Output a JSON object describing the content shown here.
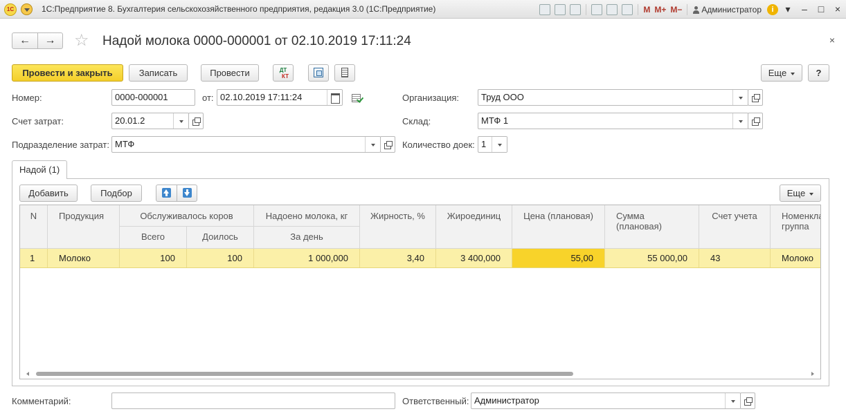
{
  "app": {
    "title": "1С:Предприятие 8. Бухгалтерия сельскохозяйственного предприятия, редакция 3.0  (1С:Предприятие)",
    "logo": "1С",
    "toolbar_icons": [
      "save-icon",
      "print-icon",
      "preview-icon",
      "open-icon",
      "calculator-icon",
      "calendar-icon"
    ],
    "memory_buttons": [
      "M",
      "M+",
      "M−"
    ],
    "user": "Администратор"
  },
  "form": {
    "title": "Надой молока 0000-000001 от 02.10.2019 17:11:24",
    "close": "×"
  },
  "toolbar": {
    "post_close": "Провести и закрыть",
    "save": "Записать",
    "post": "Провести",
    "dt": "ДТ",
    "kt": "КТ",
    "more": "Еще",
    "help": "?"
  },
  "fields": {
    "number_label": "Номер:",
    "number": "0000-000001",
    "date_label": "от:",
    "date": "02.10.2019 17:11:24",
    "org_label": "Организация:",
    "org": "Труд ООО",
    "cost_account_label": "Счет затрат:",
    "cost_account": "20.01.2",
    "warehouse_label": "Склад:",
    "warehouse": "МТФ 1",
    "department_label": "Подразделение затрат:",
    "department": "МТФ",
    "milkers_label": "Количество доек:",
    "milkers": "1",
    "comment_label": "Комментарий:",
    "comment": "",
    "responsible_label": "Ответственный:",
    "responsible": "Администратор"
  },
  "tab": {
    "label": "Надой (1)"
  },
  "table_toolbar": {
    "add": "Добавить",
    "pick": "Подбор",
    "more": "Еще"
  },
  "table": {
    "headers": {
      "n": "N",
      "product": "Продукция",
      "cows_group": "Обслуживалось коров",
      "total": "Всего",
      "milked": "Доилось",
      "milk_group": "Надоено молока, кг",
      "per_day": "За день",
      "fat": "Жирность, %",
      "fat_units": "Жироединиц",
      "price": "Цена (плановая)",
      "sum": "Сумма\n(плановая)",
      "account": "Счет учета",
      "nom_group": "Номенклатурная\nгруппа"
    },
    "rows": [
      {
        "n": "1",
        "product": "Молоко",
        "total": "100",
        "milked": "100",
        "per_day": "1 000,000",
        "fat": "3,40",
        "fat_units": "3 400,000",
        "price": "55,00",
        "sum": "55 000,00",
        "account": "43",
        "nom_group": "Молоко"
      }
    ]
  }
}
